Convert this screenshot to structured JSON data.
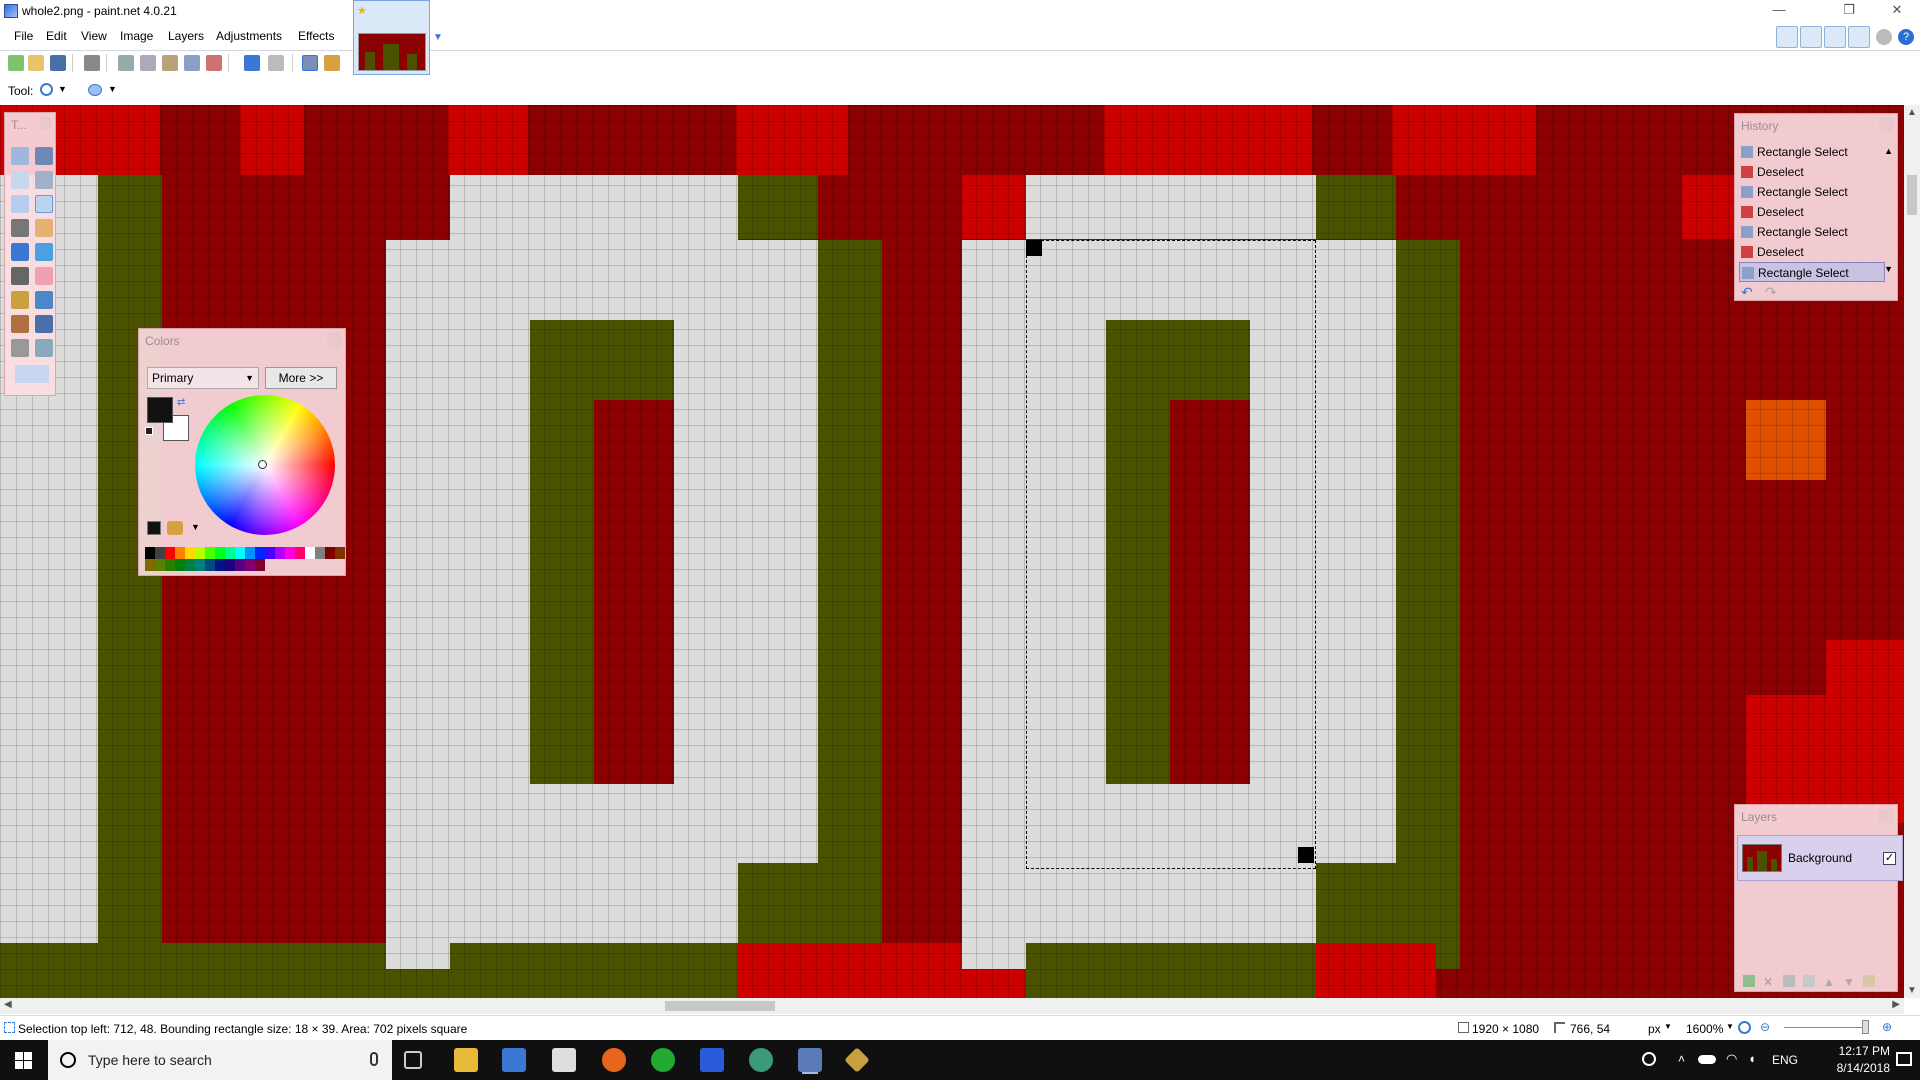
{
  "window": {
    "title": "whole2.png - paint.net 4.0.21",
    "controls": {
      "minimize": "—",
      "maximize": "❐",
      "close": "✕"
    }
  },
  "menu": [
    "File",
    "Edit",
    "View",
    "Image",
    "Layers",
    "Adjustments",
    "Effects"
  ],
  "toolbar": {
    "tool_label": "Tool:",
    "icons": [
      "new-icon",
      "open-icon",
      "save-icon",
      "print-icon",
      "cut-icon",
      "copy-icon",
      "paste-icon",
      "crop-icon",
      "deselect-icon",
      "undo-icon",
      "redo-icon",
      "grid-icon",
      "ruler-icon"
    ]
  },
  "canvas": {
    "colors": {
      "red": "#8b0000",
      "bright_red": "#cc0000",
      "olive": "#4a5200",
      "light_gray": "#dcdcdc",
      "orange": "#e05000"
    }
  },
  "tools_window": {
    "title": "T..."
  },
  "colors_window": {
    "title": "Colors",
    "mode": "Primary",
    "more_label": "More >>",
    "primary_color": "#111111",
    "secondary_color": "#ffffff"
  },
  "history_window": {
    "title": "History",
    "items": [
      {
        "label": "Rectangle Select",
        "icon": "rectangle-select-icon",
        "selected": false
      },
      {
        "label": "Deselect",
        "icon": "deselect-icon",
        "selected": false
      },
      {
        "label": "Rectangle Select",
        "icon": "rectangle-select-icon",
        "selected": false
      },
      {
        "label": "Deselect",
        "icon": "deselect-icon",
        "selected": false
      },
      {
        "label": "Rectangle Select",
        "icon": "rectangle-select-icon",
        "selected": false
      },
      {
        "label": "Deselect",
        "icon": "deselect-icon",
        "selected": false
      },
      {
        "label": "Rectangle Select",
        "icon": "rectangle-select-icon",
        "selected": true
      }
    ]
  },
  "layers_window": {
    "title": "Layers",
    "layers": [
      {
        "name": "Background",
        "visible": true
      }
    ]
  },
  "status": {
    "selection_info": "Selection top left: 712, 48. Bounding rectangle size: 18 × 39. Area: 702 pixels square",
    "image_size": "1920 × 1080",
    "cursor_pos": "766, 54",
    "units": "px",
    "zoom": "1600%"
  },
  "taskbar": {
    "search_placeholder": "Type here to search",
    "language": "ENG",
    "time": "12:17 PM",
    "date": "8/14/2018"
  }
}
